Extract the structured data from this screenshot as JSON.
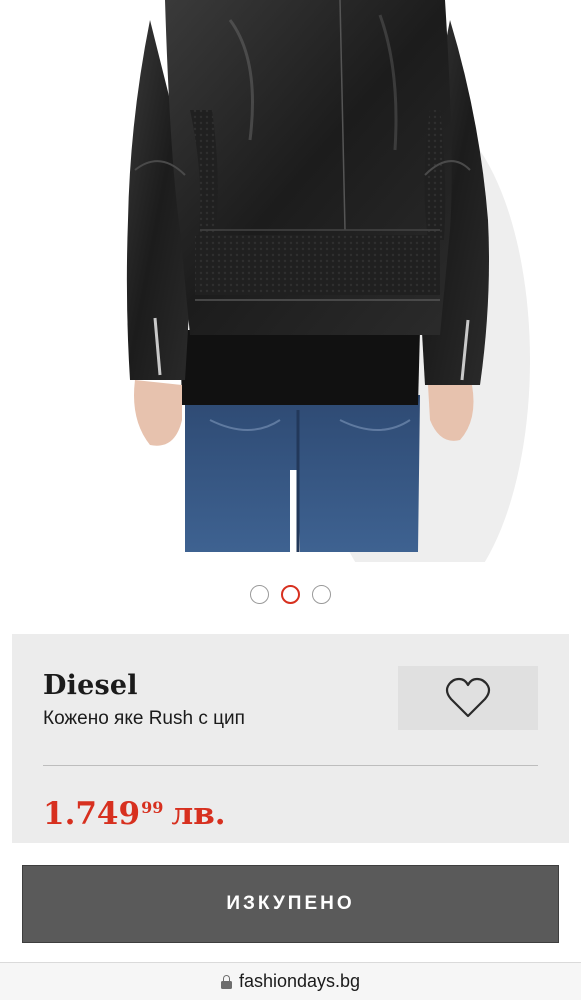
{
  "product_image": {
    "alt": "product-photo-jacket-back"
  },
  "carousel": {
    "count": 3,
    "active_index": 1
  },
  "product": {
    "brand": "Diesel",
    "name": "Кожено яке Rush с цип",
    "price": {
      "integer": "1.749",
      "decimals": "99",
      "currency": "лв."
    }
  },
  "colors": {
    "accent": "#d7301f",
    "card_bg": "#ececec",
    "button_bg": "#5a5a5a"
  },
  "icons": {
    "wishlist": "heart-outline-icon",
    "secure": "lock-icon"
  },
  "action": {
    "label": "ИЗКУПЕНО"
  },
  "browser": {
    "url": "fashiondays.bg"
  }
}
